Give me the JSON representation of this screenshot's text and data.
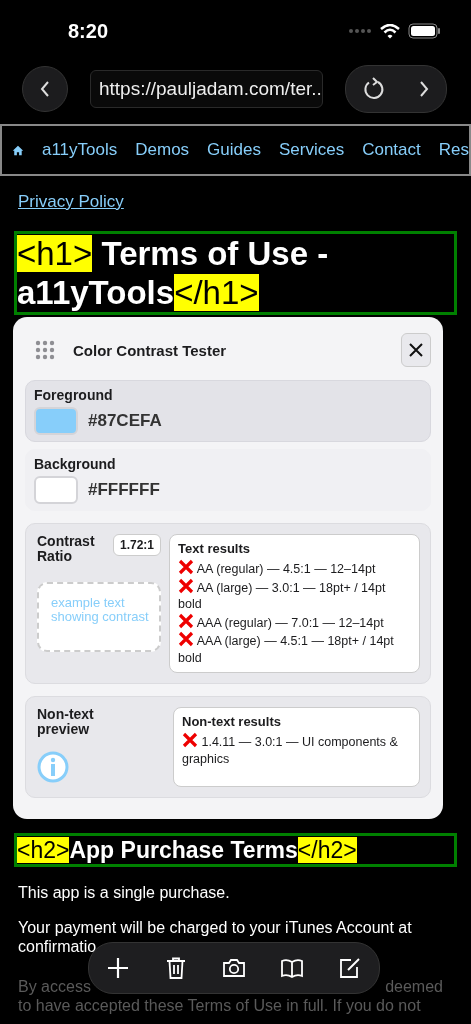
{
  "status_bar": {
    "time": "8:20"
  },
  "browser": {
    "url": "https://pauljadam.com/ter..."
  },
  "nav": {
    "items": [
      "a11yTools",
      "Demos",
      "Guides",
      "Services",
      "Contact",
      "Res"
    ]
  },
  "privacy_link": "Privacy Policy",
  "h1": {
    "open_tag": "<h1>",
    "text": "Terms of Use - a11yTools",
    "close_tag": "</h1>"
  },
  "tester": {
    "title": "Color Contrast Tester",
    "colors": [
      {
        "label": "Foreground",
        "value": "#87CEFA",
        "selected": true
      },
      {
        "label": "Background",
        "value": "#FFFFFF",
        "selected": false
      }
    ],
    "ratio_label": "Contrast Ratio",
    "ratio": "1.72:1",
    "example": "example text showing contrast",
    "text_results": {
      "title": "Text results",
      "items": [
        {
          "text": "AA (regular) — 4.5:1 — 12–14pt",
          "passed": false
        },
        {
          "text": "AA (large) — 3.0:1 — 18pt+ / 14pt bold",
          "passed": false
        },
        {
          "text": "AAA (regular) — 7.0:1 — 12–14pt",
          "passed": false
        },
        {
          "text": "AAA (large) — 4.5:1 — 18pt+ / 14pt bold",
          "passed": false
        }
      ]
    },
    "nontext_label": "Non-text preview",
    "nontext_results": {
      "title": "Non-text results",
      "items": [
        {
          "text": "1.4.11 — 3.0:1 — UI components & graphics",
          "passed": false
        }
      ]
    }
  },
  "h2": {
    "open_tag": "<h2>",
    "text": "App Purchase Terms",
    "close_tag": "</h2>"
  },
  "paragraphs": [
    {
      "lines": [
        "This app is a single purchase."
      ],
      "faded": false
    },
    {
      "lines": [
        "Your payment will be charged to your iTunes Account at",
        "confirmatio"
      ],
      "faded": false
    },
    {
      "lines": [
        "By access",
        "deemed",
        "to have accepted these Terms of Use in full. If you do not"
      ],
      "faded": true
    }
  ]
}
